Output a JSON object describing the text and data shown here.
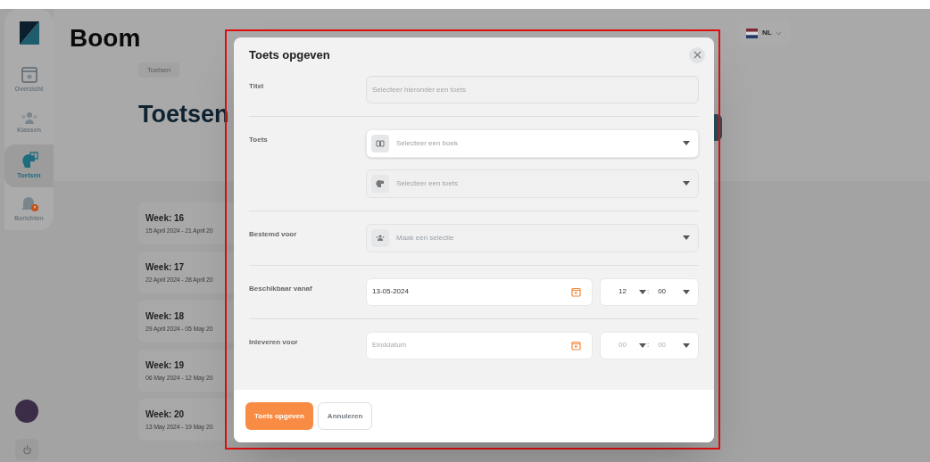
{
  "brand": "Boom",
  "sidebar": {
    "items": [
      {
        "label": "Overzicht",
        "selected": false
      },
      {
        "label": "Klassen",
        "selected": false
      },
      {
        "label": "Toetsen",
        "selected": true
      },
      {
        "label": "Berichten",
        "selected": false
      }
    ]
  },
  "breadcrumb": "Toetsen",
  "page_title": "Toetsen",
  "language": "NL",
  "weeks": [
    {
      "title": "Week: 16",
      "dates": "15 April 2024 - 21 April 20"
    },
    {
      "title": "Week: 17",
      "dates": "22 April 2024 - 28 April 20"
    },
    {
      "title": "Week: 18",
      "dates": "29 April 2024 - 05 May 20"
    },
    {
      "title": "Week: 19",
      "dates": "06 May 2024 - 12 May 20"
    },
    {
      "title": "Week: 20",
      "dates": "13 May 2024 - 19 May 20"
    }
  ],
  "dialog": {
    "title": "Toets opgeven",
    "fields": [
      {
        "label": "Titel",
        "controls": [
          {
            "kind": "text",
            "placeholder": "Selecteer hieronder een toets"
          }
        ]
      },
      {
        "label": "Toets",
        "controls": [
          {
            "kind": "select",
            "placeholder": "Selecteer een boek",
            "disabled": false
          },
          {
            "kind": "select",
            "placeholder": "Selecteer een toets",
            "disabled": true
          }
        ]
      },
      {
        "label": "Bestemd voor",
        "controls": [
          {
            "kind": "select",
            "placeholder": "Maak een selectie",
            "disabled": true
          }
        ]
      },
      {
        "label": "Beschikbaar vanaf",
        "controls": [
          {
            "kind": "date",
            "value": "13-05-2024"
          },
          {
            "kind": "time",
            "hour": "12",
            "separator": ":",
            "minute": "00",
            "filled": true
          }
        ]
      },
      {
        "label": "Inleveren voor",
        "controls": [
          {
            "kind": "date",
            "placeholder": "Einddatum"
          },
          {
            "kind": "time",
            "hour": "00",
            "separator": ":",
            "minute": "00",
            "filled": false
          }
        ]
      }
    ],
    "buttons": [
      {
        "label": "Toets opgeven",
        "primary": true
      },
      {
        "label": "Annuleren",
        "primary": false
      }
    ]
  }
}
